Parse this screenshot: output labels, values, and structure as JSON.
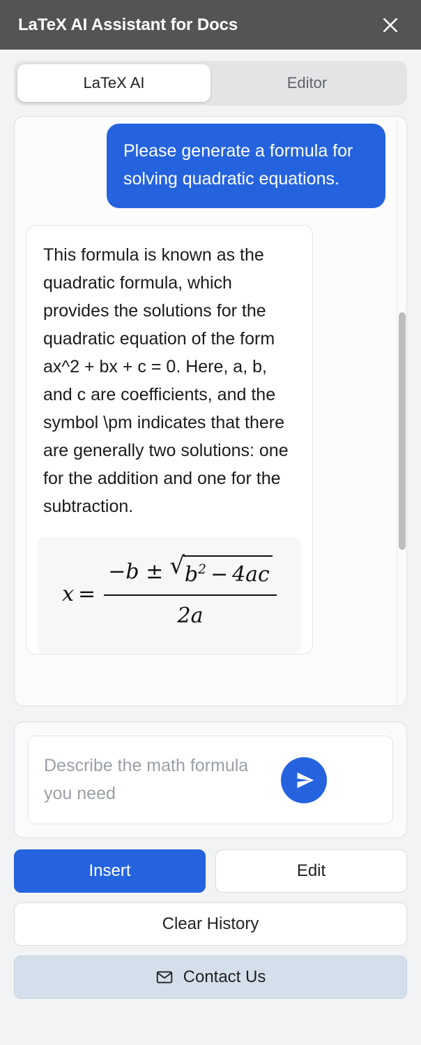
{
  "header": {
    "title": "LaTeX AI Assistant for Docs",
    "close_icon": "close-icon"
  },
  "tabs": [
    {
      "label": "LaTeX AI",
      "active": true
    },
    {
      "label": "Editor",
      "active": false
    }
  ],
  "chat": {
    "messages": [
      {
        "role": "user",
        "text": "Please generate a formula for solving quadratic equations."
      },
      {
        "role": "assistant",
        "text": "This formula is known as the quadratic formula, which provides the solutions for the quadratic equation of the form ax^2 + bx + c = 0. Here, a, b, and c are coefficients, and the symbol \\pm indicates that there are generally two solutions: one for the addition and one for the subtraction.",
        "formula": {
          "latex": "x = \\frac{-b \\pm \\sqrt{b^2 - 4ac}}{2a}",
          "variable": "x",
          "equals": "=",
          "numerator_lead": "−b ±",
          "radicand_base": "b",
          "radicand_exponent": "2",
          "radicand_minus": "−",
          "radicand_tail": "4ac",
          "denominator": "2a"
        }
      }
    ]
  },
  "input": {
    "placeholder": "Describe the math formula you need",
    "value": "",
    "send_icon": "send-icon"
  },
  "buttons": {
    "insert": "Insert",
    "edit": "Edit",
    "clear_history": "Clear History",
    "contact_us": "Contact Us",
    "contact_icon": "envelope-icon"
  },
  "colors": {
    "accent_blue": "#2563de",
    "header_gray": "#545454",
    "page_bg": "#f1f3f4",
    "contact_bg": "#d5dfeb"
  }
}
